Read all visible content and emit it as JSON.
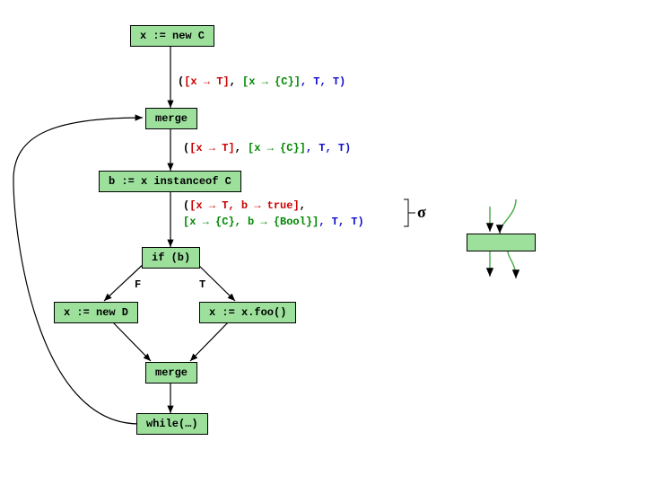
{
  "nodes": {
    "n1": "x := new C",
    "n2": "merge",
    "n3": "b := x instanceof C",
    "n4": "if (b)",
    "n5": "x := new D",
    "n6": "x := x.foo()",
    "n7": "merge",
    "n8": "while(…)"
  },
  "edge_labels": {
    "F": "F",
    "T": "T"
  },
  "annotations": {
    "a1": {
      "pre": "(",
      "p1a": "[x → ",
      "p1b": "T",
      "p1c": "]",
      "sep": ", ",
      "p2a": "[x → {C}]",
      "tail": ", T, T)"
    },
    "a2": {
      "pre": "(",
      "p1a": "[x → ",
      "p1b": "T",
      "p1c": "]",
      "sep": ", ",
      "p2a": "[x → {C}]",
      "tail": ", T, T)"
    },
    "a3line1": {
      "pre": "(",
      "p1a": "[x → ",
      "p1b": "T",
      "p1c": ",",
      "gap": "   ",
      "p2a": "b → true]",
      "tail": ","
    },
    "a3line2": {
      "p1a": " [x → {C}, b → {Bool}]",
      "tail": ", T, T)"
    }
  },
  "sigma": "σ",
  "chart_data": {
    "type": "flowchart",
    "nodes": [
      {
        "id": "n1",
        "label": "x := new C"
      },
      {
        "id": "n2",
        "label": "merge"
      },
      {
        "id": "n3",
        "label": "b := x instanceof C"
      },
      {
        "id": "n4",
        "label": "if (b)"
      },
      {
        "id": "n5",
        "label": "x := new D"
      },
      {
        "id": "n6",
        "label": "x := x.foo()"
      },
      {
        "id": "n7",
        "label": "merge"
      },
      {
        "id": "n8",
        "label": "while(…)"
      }
    ],
    "edges": [
      {
        "from": "n1",
        "to": "n2"
      },
      {
        "from": "n2",
        "to": "n3"
      },
      {
        "from": "n3",
        "to": "n4"
      },
      {
        "from": "n4",
        "to": "n5",
        "label": "F"
      },
      {
        "from": "n4",
        "to": "n6",
        "label": "T"
      },
      {
        "from": "n5",
        "to": "n7"
      },
      {
        "from": "n6",
        "to": "n7"
      },
      {
        "from": "n7",
        "to": "n8"
      },
      {
        "from": "n8",
        "to": "n2",
        "back_edge": true
      }
    ],
    "annotations": [
      {
        "after": "n1",
        "state": "([x → T], [x → {C}], T, T)"
      },
      {
        "after": "n2",
        "state": "([x → T], [x → {C}], T, T)"
      },
      {
        "after": "n3",
        "state": "([x → T, b → true], [x → {C}, b → {Bool}], T, T)",
        "name": "σ"
      }
    ],
    "side_diagram": {
      "description": "small green rectangle with two incoming arrows, one straight through and one looping, two outgoing arrows"
    }
  }
}
